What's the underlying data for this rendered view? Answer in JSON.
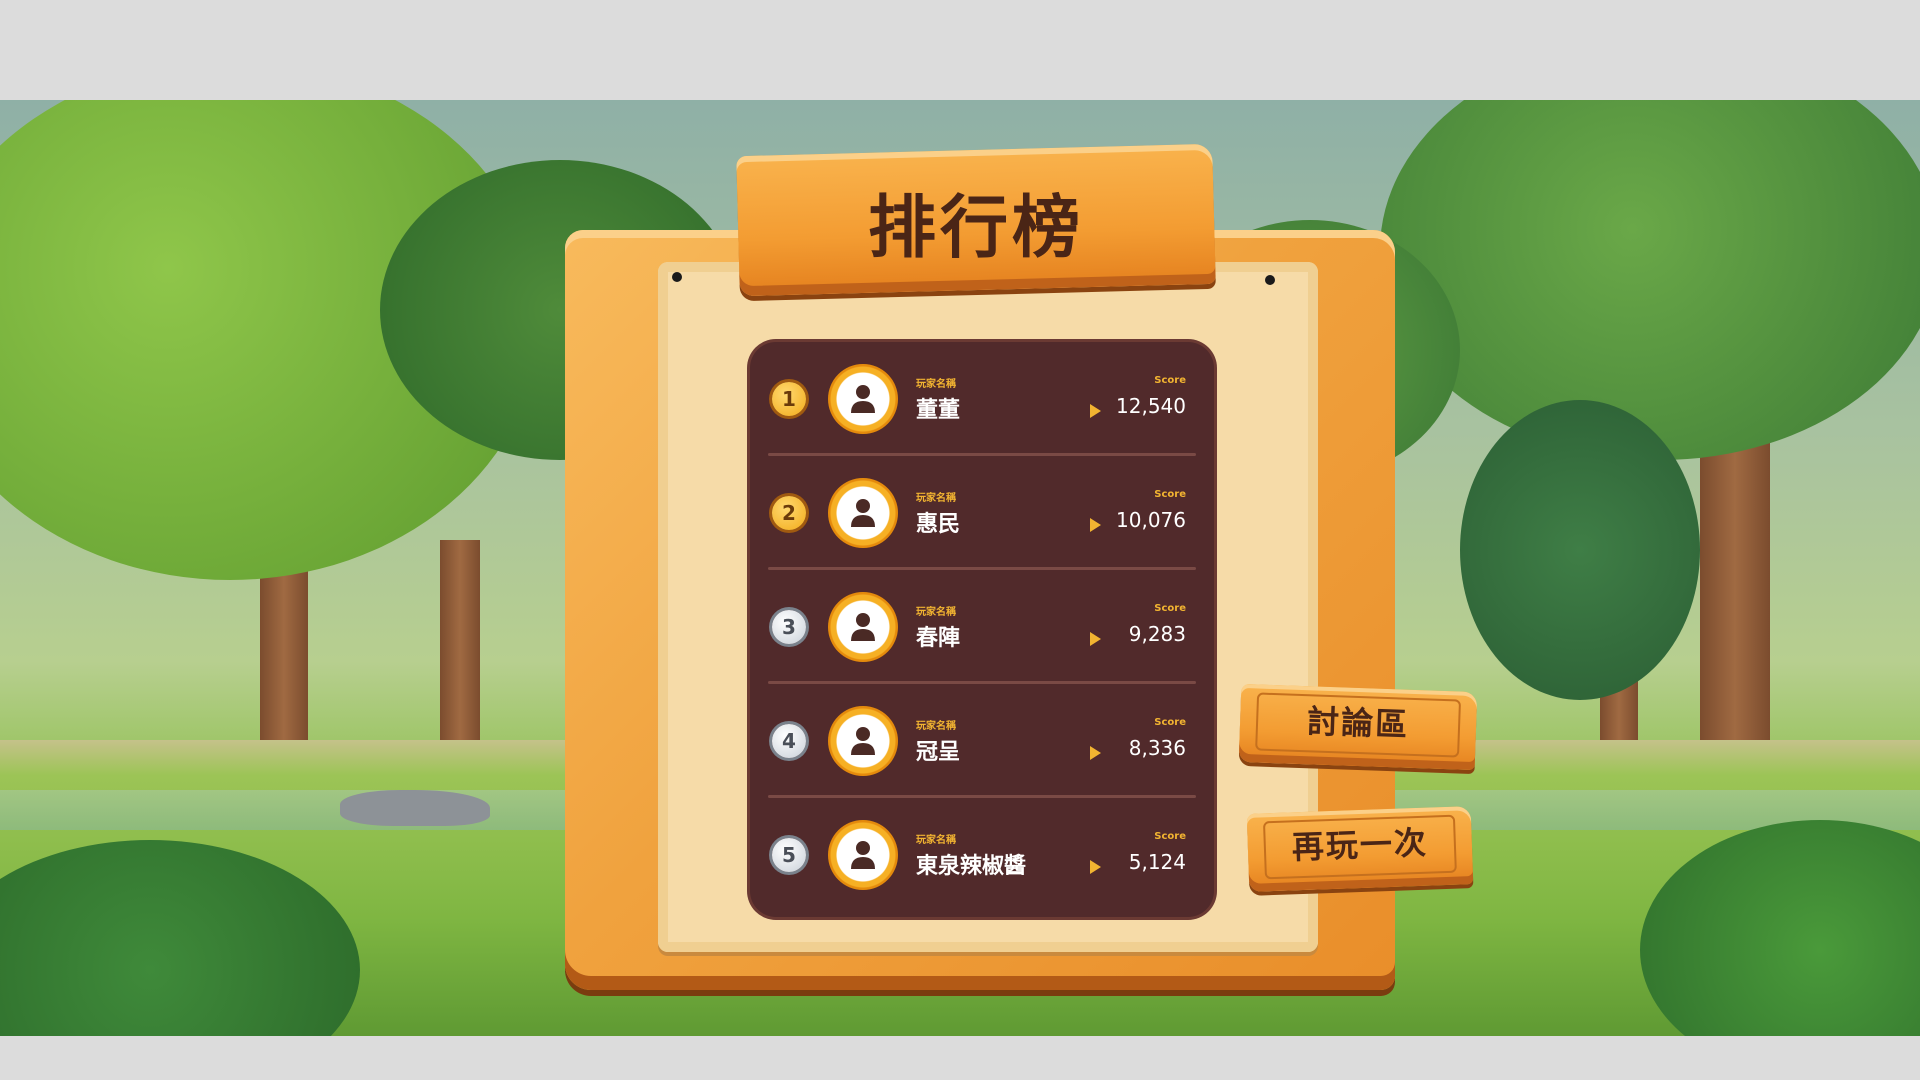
{
  "title": "排行榜",
  "leaderboard": {
    "name_label": "玩家名稱",
    "score_label": "Score",
    "entries": [
      {
        "rank": "1",
        "name": "董董",
        "score": "12,540",
        "medal": "gold"
      },
      {
        "rank": "2",
        "name": "惠民",
        "score": "10,076",
        "medal": "gold"
      },
      {
        "rank": "3",
        "name": "春陣",
        "score": "9,283",
        "medal": "silver"
      },
      {
        "rank": "4",
        "name": "冠呈",
        "score": "8,336",
        "medal": "silver"
      },
      {
        "rank": "5",
        "name": "東泉辣椒醬",
        "score": "5,124",
        "medal": "silver"
      }
    ]
  },
  "buttons": {
    "forum": "討論區",
    "play_again": "再玩一次"
  },
  "colors": {
    "panel": "#512a2b",
    "accent": "#f2b431",
    "wood": "#f39c32"
  }
}
